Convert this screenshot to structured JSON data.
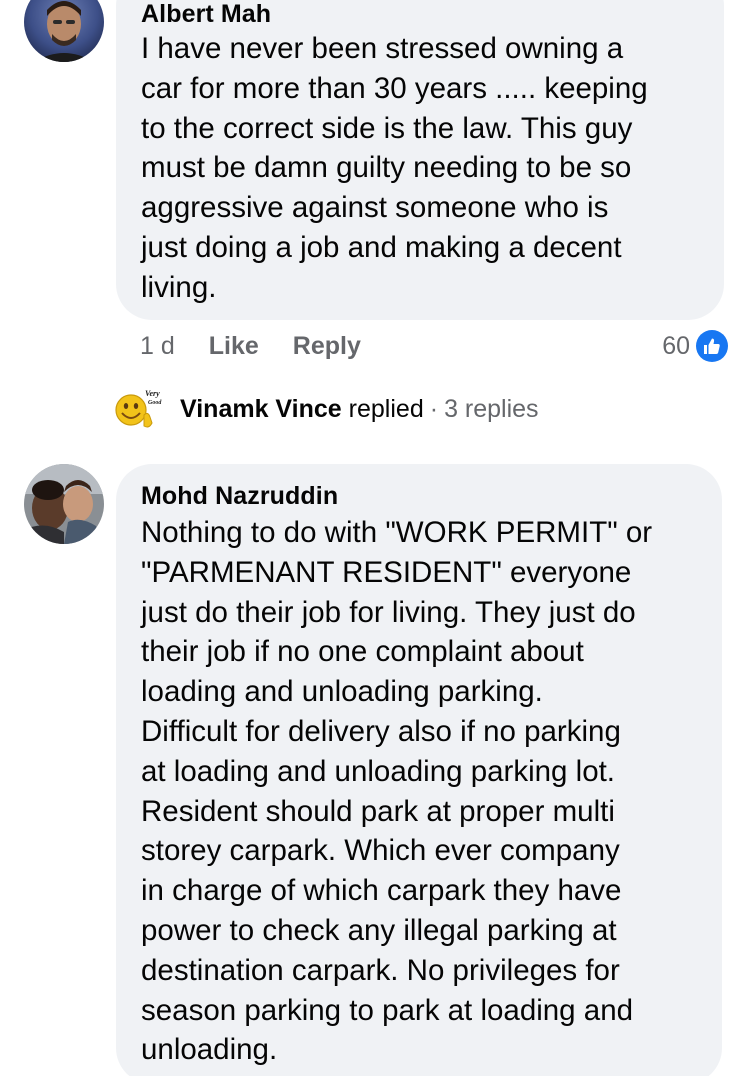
{
  "comment_1": {
    "author": "Albert Mah",
    "body_lines": [
      "I have never been stressed owning a",
      "car for more than 30 years ..... keeping",
      "to the correct side is the law. This guy",
      "must be damn guilty needing to be so",
      "aggressive against someone who is",
      "just doing a job and making a decent",
      "living."
    ],
    "time": "1 d",
    "like_label": "Like",
    "reply_label": "Reply",
    "reaction_count": "60",
    "reaction_icon": "thumbs-up-icon"
  },
  "replies_summary": {
    "avatar_text_1": "Very",
    "avatar_text_2": "Good",
    "name": "Vinamk Vince",
    "replied": "replied",
    "dot": "·",
    "count": "3 replies"
  },
  "comment_2": {
    "author": "Mohd Nazruddin",
    "body_lines": [
      "Nothing to do with \"WORK PERMIT\" or",
      "\"PARMENANT RESIDENT\" everyone",
      "just do their job for living. They just do",
      "their job if no one complaint about",
      "loading and unloading parking.",
      "Difficult for delivery also if no parking",
      "at loading and unloading parking lot.",
      "Resident should park at proper multi",
      "storey carpark. Which ever company",
      "in charge of which carpark they have",
      "power to check any illegal parking at",
      "destination carpark. No privileges for",
      "season parking to park at loading and",
      "unloading."
    ]
  },
  "colors": {
    "bubble": "#f0f2f5",
    "secondary_text": "#65676b",
    "like_blue": "#1877f2"
  }
}
